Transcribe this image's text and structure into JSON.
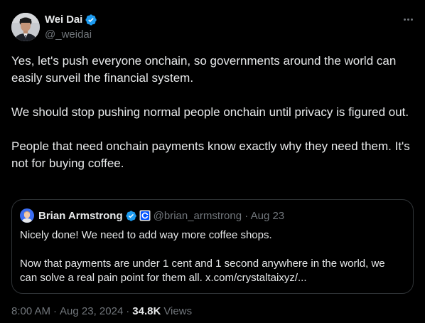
{
  "author": {
    "display_name": "Wei Dai",
    "handle": "@_weidai",
    "verified": true
  },
  "tweet": {
    "paragraphs": [
      "Yes, let's push everyone onchain, so governments around the world can easily surveil the financial system.",
      "We should stop pushing normal people onchain until privacy is figured out.",
      "People that need onchain payments know exactly why they need them. It's not for buying coffee."
    ]
  },
  "quoted_tweet": {
    "display_name": "Brian Armstrong",
    "handle": "@brian_armstrong",
    "separator": "·",
    "date": "Aug 23",
    "paragraphs": [
      "Nicely done! We need to add way more coffee shops.",
      "Now that payments are under 1 cent and 1 second anywhere in the world, we can solve a real pain point for them all. x.com/crystaltaixyz/..."
    ]
  },
  "footer": {
    "time": "8:00 AM",
    "separator": "·",
    "date": "Aug 23, 2024",
    "views_count": "34.8K",
    "views_label": "Views"
  },
  "icons": {
    "verified": "verified-badge-icon",
    "affiliate": "coinbase-affiliate-icon",
    "more": "more-options-icon"
  },
  "colors": {
    "background": "#000000",
    "text_primary": "#e7e9ea",
    "text_secondary": "#71767b",
    "verified_blue": "#1d9bf0",
    "border": "#2f3336"
  }
}
